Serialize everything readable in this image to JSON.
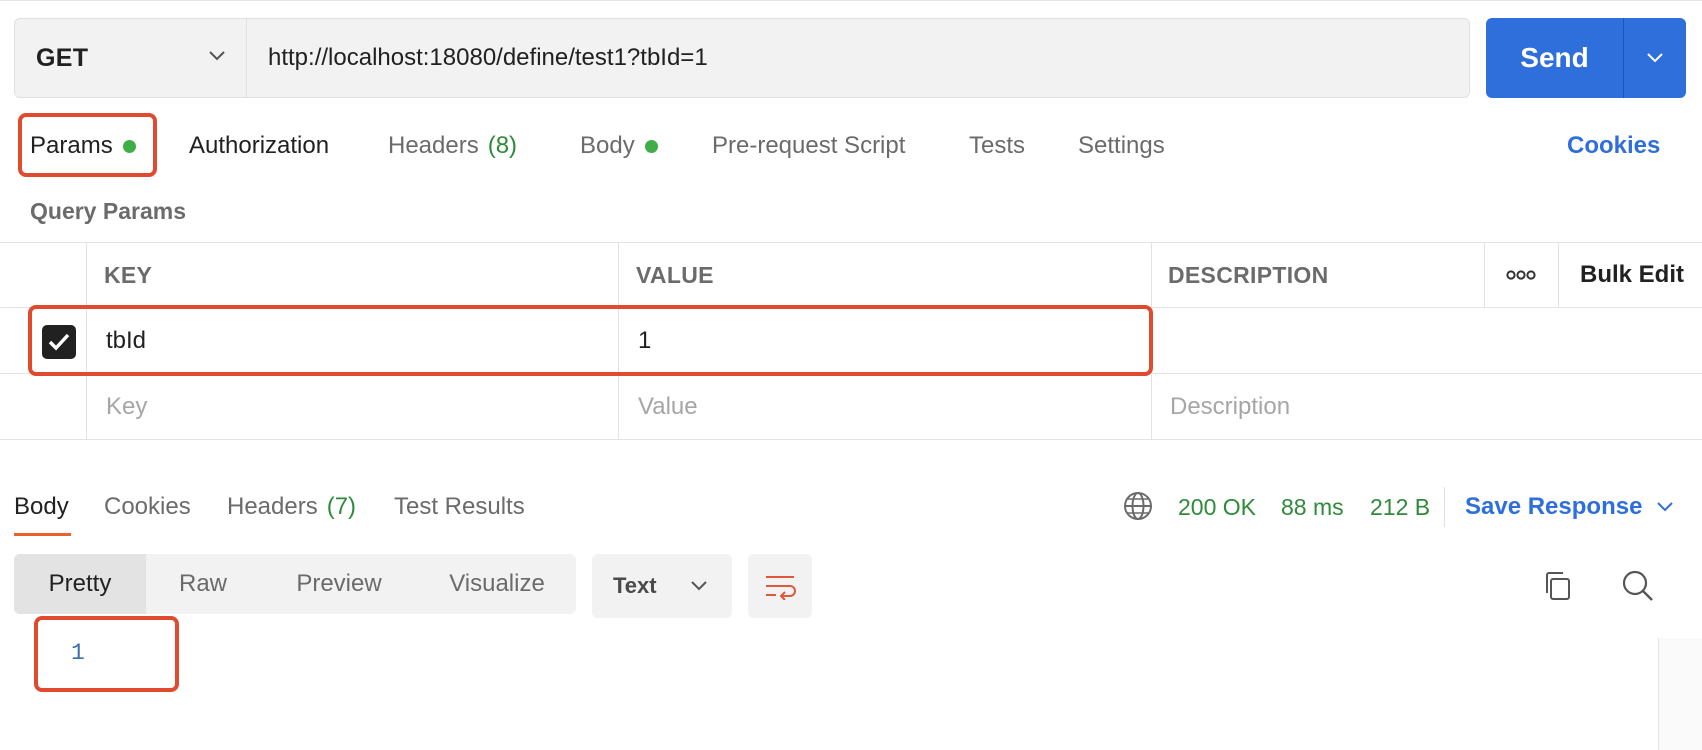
{
  "request": {
    "method": "GET",
    "url": "http://localhost:18080/define/test1?tbId=1",
    "send_label": "Send"
  },
  "request_tabs": {
    "params": "Params",
    "authorization": "Authorization",
    "headers": "Headers",
    "headers_count": "(8)",
    "body": "Body",
    "pre_request": "Pre-request Script",
    "tests": "Tests",
    "settings": "Settings",
    "cookies": "Cookies"
  },
  "query_params": {
    "title": "Query Params",
    "columns": {
      "key": "KEY",
      "value": "VALUE",
      "description": "DESCRIPTION",
      "bulk_edit": "Bulk Edit"
    },
    "rows": [
      {
        "checked": true,
        "key": "tbId",
        "value": "1",
        "description": ""
      }
    ],
    "placeholders": {
      "key": "Key",
      "value": "Value",
      "description": "Description"
    }
  },
  "response": {
    "tabs": {
      "body": "Body",
      "cookies": "Cookies",
      "headers": "Headers",
      "headers_count": "(7)",
      "test_results": "Test Results"
    },
    "status": "200 OK",
    "time": "88 ms",
    "size": "212 B",
    "save_label": "Save Response",
    "views": {
      "pretty": "Pretty",
      "raw": "Raw",
      "preview": "Preview",
      "visualize": "Visualize"
    },
    "format": "Text",
    "line_number": "1"
  },
  "colors": {
    "accent": "#2f6fdc",
    "success": "#2f8a3a",
    "highlight": "#e04a2e",
    "tab_underline": "#e8632b"
  },
  "icons": [
    "chevron-down-icon",
    "checkmark-icon",
    "more-horizontal-icon",
    "globe-icon",
    "wrap-lines-icon",
    "copy-icon",
    "search-icon"
  ]
}
